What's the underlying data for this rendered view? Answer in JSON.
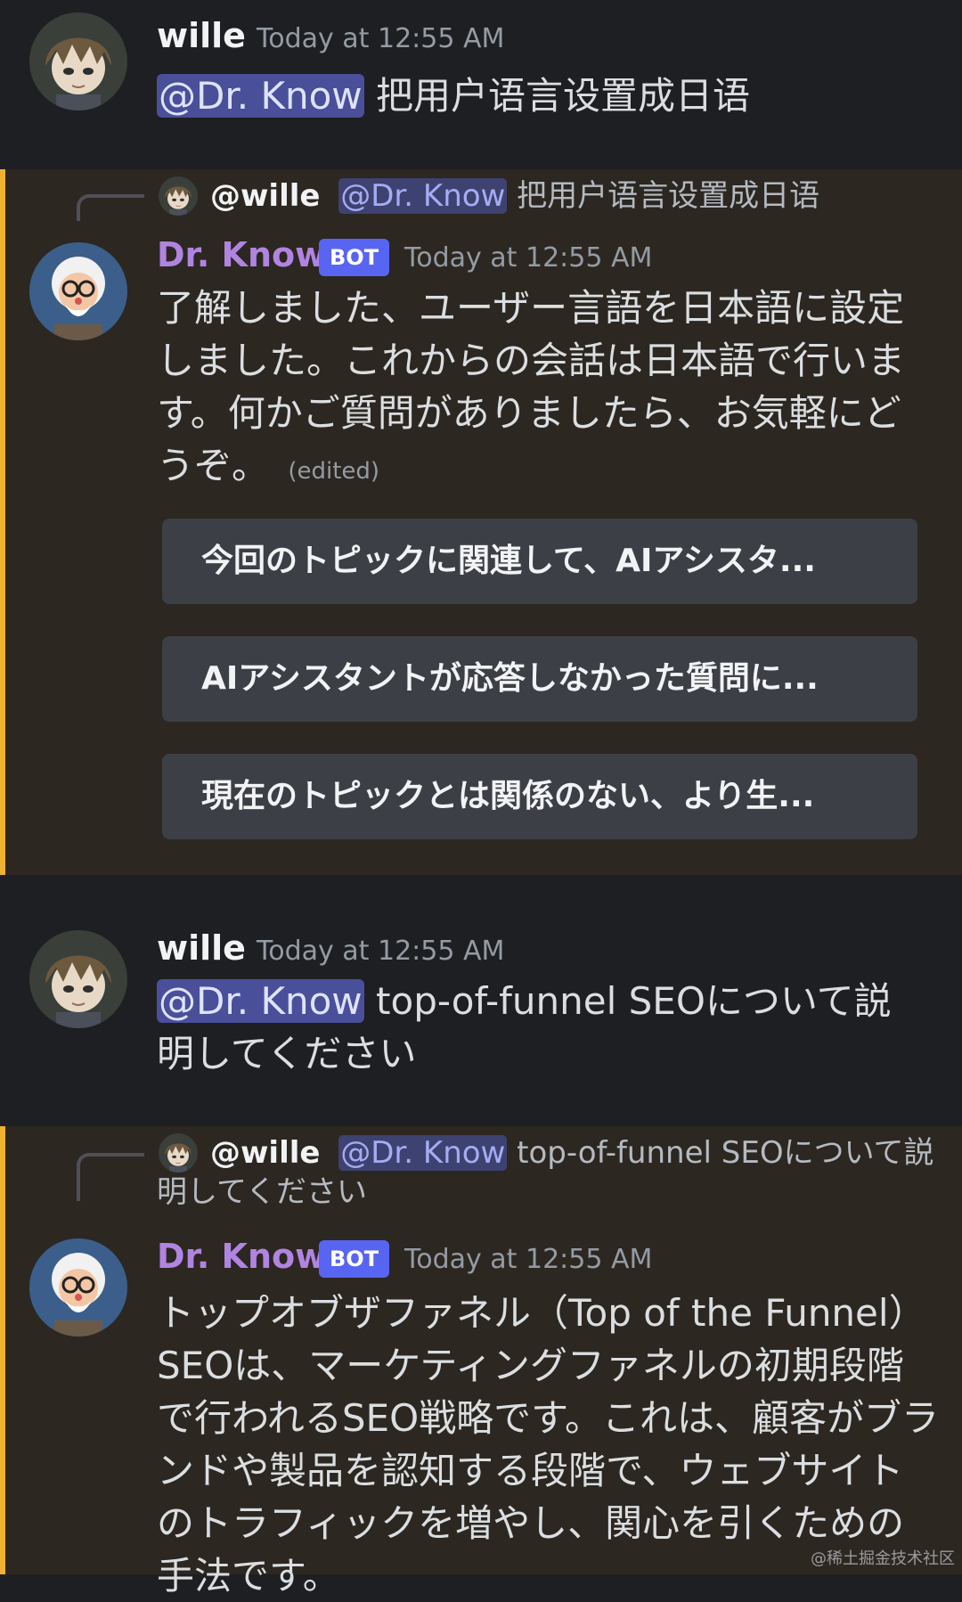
{
  "colors": {
    "user_bg": "#1e1f22",
    "bot_bg": "#2c2720",
    "highlight_bar": "#f0b232",
    "bot_name": "#b084e0",
    "bot_badge": "#5865f2",
    "mention_bg": "#4a4f9a"
  },
  "icons": {
    "user_avatar": "anime-character-avatar-icon",
    "bot_avatar": "professor-avatar-icon"
  },
  "messages": [
    {
      "author": "wille",
      "timestamp": "Today at 12:55 AM",
      "mention": "@Dr. Know",
      "text": "把用户语言设置成日语"
    },
    {
      "author": "Dr. Know",
      "badge": "BOT",
      "timestamp": "Today at 12:55 AM",
      "reply": {
        "author": "@wille",
        "mention": "@Dr. Know",
        "text": "把用户语言设置成日语"
      },
      "text": "了解しました、ユーザー言語を日本語に設定しました。これからの会話は日本語で行います。何かご質問がありましたら、お気軽にどうぞ。",
      "edited": "(edited)",
      "buttons": [
        "今回のトピックに関連して、AIアシスタ...",
        "AIアシスタントが応答しなかった質問に...",
        "現在のトピックとは関係のない、より生..."
      ]
    },
    {
      "author": "wille",
      "timestamp": "Today at 12:55 AM",
      "mention": "@Dr. Know",
      "text": "top-of-funnel SEOについて説明してください"
    },
    {
      "author": "Dr. Know",
      "badge": "BOT",
      "timestamp": "Today at 12:55 AM",
      "reply": {
        "author": "@wille",
        "mention": "@Dr. Know",
        "text": "top-of-funnel SEOについて説明してください"
      },
      "text": "トップオブザファネル（Top of the Funnel）SEOは、マーケティングファネルの初期段階で行われるSEO戦略です。これは、顧客がブランドや製品を認知する段階で、ウェブサイトのトラフィックを増やし、関心を引くための手法です。"
    }
  ],
  "watermark": "@稀土掘金技术社区"
}
